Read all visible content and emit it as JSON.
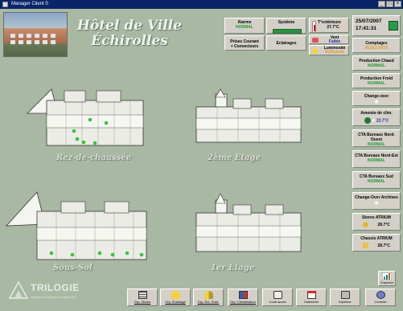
{
  "window": {
    "title": "Manager Client 0",
    "buttons": [
      "_",
      "□",
      "×"
    ]
  },
  "header": {
    "title_line1": "Hôtel de Ville",
    "title_line2": "Échirolles"
  },
  "status": {
    "alarme": {
      "label": "Alarme",
      "value": "NORMAL"
    },
    "systeme": {
      "label": "Système"
    },
    "prises": {
      "label_line1": "Prises Courant",
      "label_line2": "+ Convecteurs"
    },
    "eclairages": {
      "label": "Eclairages"
    },
    "temp_ext": {
      "label": "T°extérieure",
      "value": "27.7°C"
    },
    "vent": {
      "label": "Vent",
      "value": "Faible"
    },
    "luminosite": {
      "label": "Luminosité",
      "value": "Suffisante"
    }
  },
  "clock": {
    "date": "25/07/2007",
    "time": "17:41:31"
  },
  "right_panels": [
    {
      "label": "Comptages",
      "value": "RESULTATS"
    },
    {
      "label": "Production Chaud",
      "value": "NORMAL"
    },
    {
      "label": "Production Froid",
      "value": "NORMAL"
    },
    {
      "label": "Change-over",
      "value": ""
    },
    {
      "label": "Amenée de clim.",
      "value": "22.7°C"
    },
    {
      "label": "CTA Bureaux Nord-Ouest",
      "value": "NORMAL"
    },
    {
      "label": "CTA Bureaux Nord-Est",
      "value": "NORMAL"
    },
    {
      "label": "CTA Bureaux Sud",
      "value": "NORMAL"
    },
    {
      "label": "Change-Over Archives",
      "value": ""
    },
    {
      "label": "Stores ATRIUM",
      "value": "28.7°C"
    },
    {
      "label": "Chassis ATRIUM",
      "value": "28.7°C"
    }
  ],
  "floors": {
    "rdc": "Rez-de-chaussée",
    "etage2": "2ème Etage",
    "soussol": "Sous-Sol",
    "etage1": "1er Etage"
  },
  "logo": {
    "word": "TRILOGIE",
    "tag": "intelligent building management"
  },
  "graph_button": {
    "label": "Grapheur"
  },
  "toolbar": [
    {
      "label": "Grp. Stores",
      "icon": "stores-icon"
    },
    {
      "label": "Grp. Éclairage",
      "icon": "lamp-icon"
    },
    {
      "label": "Grp. Écl. Grad.",
      "icon": "dimmer-lamp-icon"
    },
    {
      "label": "Grp. Climatisation",
      "icon": "climate-icon"
    },
    {
      "label": "Code accès",
      "icon": "key-icon"
    },
    {
      "label": "Calendrier",
      "icon": "calendar-icon"
    },
    {
      "label": "Imprimer",
      "icon": "printer-icon"
    },
    {
      "label": "Contrôle",
      "icon": "control-icon"
    }
  ],
  "colors": {
    "titlebar": "#0a246a",
    "status_green": "#1d9a37",
    "value_green": "#1f9a2e",
    "background": "#a8b8a2"
  }
}
